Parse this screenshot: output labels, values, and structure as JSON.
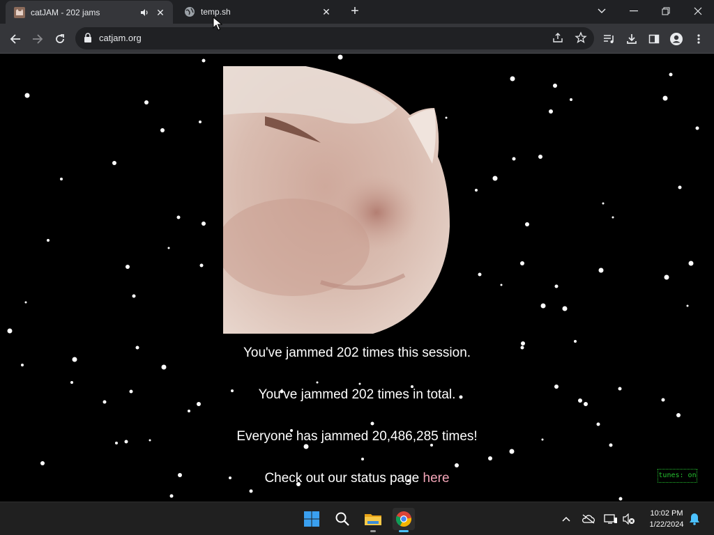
{
  "browser": {
    "tabs": [
      {
        "title": "catJAM - 202 jams",
        "active": true,
        "audio": true
      },
      {
        "title": "temp.sh",
        "active": false
      }
    ],
    "address": "catjam.org"
  },
  "page": {
    "session_message": "You've jammed 202 times this session.",
    "total_message": "You've jammed 202 times in total.",
    "everyone_message": "Everyone has jammed 20,486,285 times!",
    "status_prefix": "Check out our status page ",
    "status_link": "here",
    "tunes_toggle": "tunes: on"
  },
  "taskbar": {
    "apps": [
      "start-icon",
      "search-icon",
      "file-explorer-icon",
      "chrome-icon"
    ],
    "clock": {
      "time": "10:02 PM",
      "date": "1/22/2024"
    }
  },
  "colors": {
    "tab_strip": "#202124",
    "toolbar": "#35363a",
    "omnibox": "#202124",
    "page_bg": "#000000",
    "link": "#f4a6b8",
    "tunes_green": "#25c22f",
    "taskbar": "#202020"
  }
}
